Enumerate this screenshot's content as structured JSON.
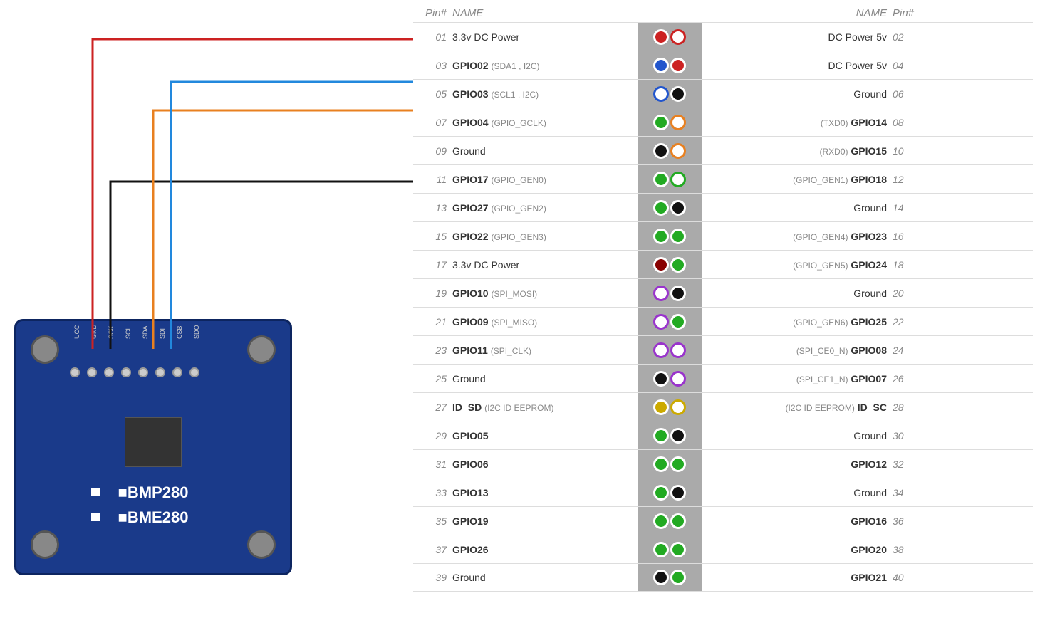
{
  "header": {
    "col_pin": "Pin#",
    "col_name": "NAME"
  },
  "sensor": {
    "label_bmp": "■BMP280",
    "label_bme": "■BME280",
    "pins": [
      "UCC",
      "GND",
      "SCK",
      "SCL",
      "SDA",
      "SDI",
      "CSB",
      "SDO"
    ]
  },
  "pins": [
    {
      "num_l": "01",
      "name_l": "3.3v DC Power",
      "pin_l": "red-filled",
      "pin_r": "red-outline",
      "name_r": "DC Power 5v",
      "num_r": "02"
    },
    {
      "num_l": "03",
      "name_l": "GPIO02 (SDA1 , I2C)",
      "pin_l": "blue-filled",
      "pin_r": "red-filled",
      "name_r": "DC Power 5v",
      "num_r": "04",
      "bold_l": "GPIO02",
      "sub_l": "(SDA1 , I2C)"
    },
    {
      "num_l": "05",
      "name_l": "GPIO03 (SCL1 , I2C)",
      "pin_l": "blue-outline",
      "pin_r": "black-filled",
      "name_r": "Ground",
      "num_r": "06",
      "bold_l": "GPIO03",
      "sub_l": "(SCL1 , I2C)"
    },
    {
      "num_l": "07",
      "name_l": "GPIO04 (GPIO_GCLK)",
      "pin_l": "green-filled",
      "pin_r": "orange-outline",
      "name_r": "(TXD0) GPIO14",
      "num_r": "08",
      "bold_l": "GPIO04",
      "sub_l": "(GPIO_GCLK)",
      "bold_r": "GPIO14",
      "sub_r": "(TXD0)"
    },
    {
      "num_l": "09",
      "name_l": "Ground",
      "pin_l": "black-filled",
      "pin_r": "orange-outline",
      "name_r": "(RXD0) GPIO15",
      "num_r": "10",
      "bold_r": "GPIO15",
      "sub_r": "(RXD0)"
    },
    {
      "num_l": "11",
      "name_l": "GPIO17 (GPIO_GEN0)",
      "pin_l": "green-filled",
      "pin_r": "green-outline",
      "name_r": "(GPIO_GEN1) GPIO18",
      "num_r": "12",
      "bold_l": "GPIO17",
      "sub_l": "(GPIO_GEN0)",
      "bold_r": "GPIO18",
      "sub_r": "(GPIO_GEN1)"
    },
    {
      "num_l": "13",
      "name_l": "GPIO27 (GPIO_GEN2)",
      "pin_l": "green-filled",
      "pin_r": "black-filled",
      "name_r": "Ground",
      "num_r": "14",
      "bold_l": "GPIO27",
      "sub_l": "(GPIO_GEN2)"
    },
    {
      "num_l": "15",
      "name_l": "GPIO22 (GPIO_GEN3)",
      "pin_l": "green-filled",
      "pin_r": "green-filled",
      "name_r": "(GPIO_GEN4) GPIO23",
      "num_r": "16",
      "bold_l": "GPIO22",
      "sub_l": "(GPIO_GEN3)",
      "bold_r": "GPIO23",
      "sub_r": "(GPIO_GEN4)"
    },
    {
      "num_l": "17",
      "name_l": "3.3v DC Power",
      "pin_l": "darkred-filled",
      "pin_r": "green-filled",
      "name_r": "(GPIO_GEN5) GPIO24",
      "num_r": "18",
      "bold_r": "GPIO24",
      "sub_r": "(GPIO_GEN5)"
    },
    {
      "num_l": "19",
      "name_l": "GPIO10 (SPI_MOSI)",
      "pin_l": "purple-outline",
      "pin_r": "black-filled",
      "name_r": "Ground",
      "num_r": "20",
      "bold_l": "GPIO10",
      "sub_l": "(SPI_MOSI)"
    },
    {
      "num_l": "21",
      "name_l": "GPIO09 (SPI_MISO)",
      "pin_l": "purple-outline",
      "pin_r": "green-filled",
      "name_r": "(GPIO_GEN6) GPIO25",
      "num_r": "22",
      "bold_l": "GPIO09",
      "sub_l": "(SPI_MISO)",
      "bold_r": "GPIO25",
      "sub_r": "(GPIO_GEN6)"
    },
    {
      "num_l": "23",
      "name_l": "GPIO11 (SPI_CLK)",
      "pin_l": "purple-outline",
      "pin_r": "purple-outline",
      "name_r": "(SPI_CE0_N) GPIO08",
      "num_r": "24",
      "bold_l": "GPIO11",
      "sub_l": "(SPI_CLK)",
      "bold_r": "GPIO08",
      "sub_r": "(SPI_CE0_N)"
    },
    {
      "num_l": "25",
      "name_l": "Ground",
      "pin_l": "black-filled",
      "pin_r": "purple-outline",
      "name_r": "(SPI_CE1_N) GPIO07",
      "num_r": "26",
      "bold_r": "GPIO07",
      "sub_r": "(SPI_CE1_N)"
    },
    {
      "num_l": "27",
      "name_l": "ID_SD (I2C ID EEPROM)",
      "pin_l": "yellow-filled",
      "pin_r": "yellow-outline",
      "name_r": "(I2C ID EEPROM) ID_SC",
      "num_r": "28",
      "bold_l": "ID_SD",
      "sub_l": "(I2C ID EEPROM)",
      "bold_r": "ID_SC",
      "sub_r": "(I2C ID EEPROM)"
    },
    {
      "num_l": "29",
      "name_l": "GPIO05",
      "pin_l": "green-filled",
      "pin_r": "black-filled",
      "name_r": "Ground",
      "num_r": "30",
      "bold_l": "GPIO05"
    },
    {
      "num_l": "31",
      "name_l": "GPIO06",
      "pin_l": "green-filled",
      "pin_r": "green-filled",
      "name_r": "GPIO12",
      "num_r": "32",
      "bold_l": "GPIO06",
      "bold_r": "GPIO12"
    },
    {
      "num_l": "33",
      "name_l": "GPIO13",
      "pin_l": "green-filled",
      "pin_r": "black-filled",
      "name_r": "Ground",
      "num_r": "34",
      "bold_l": "GPIO13"
    },
    {
      "num_l": "35",
      "name_l": "GPIO19",
      "pin_l": "green-filled",
      "pin_r": "green-filled",
      "name_r": "GPIO16",
      "num_r": "36",
      "bold_l": "GPIO19",
      "bold_r": "GPIO16"
    },
    {
      "num_l": "37",
      "name_l": "GPIO26",
      "pin_l": "green-filled",
      "pin_r": "green-filled",
      "name_r": "GPIO20",
      "num_r": "38",
      "bold_l": "GPIO26",
      "bold_r": "GPIO20"
    },
    {
      "num_l": "39",
      "name_l": "Ground",
      "pin_l": "black-filled",
      "pin_r": "green-filled",
      "name_r": "GPIO21",
      "num_r": "40",
      "bold_r": "GPIO21"
    }
  ]
}
